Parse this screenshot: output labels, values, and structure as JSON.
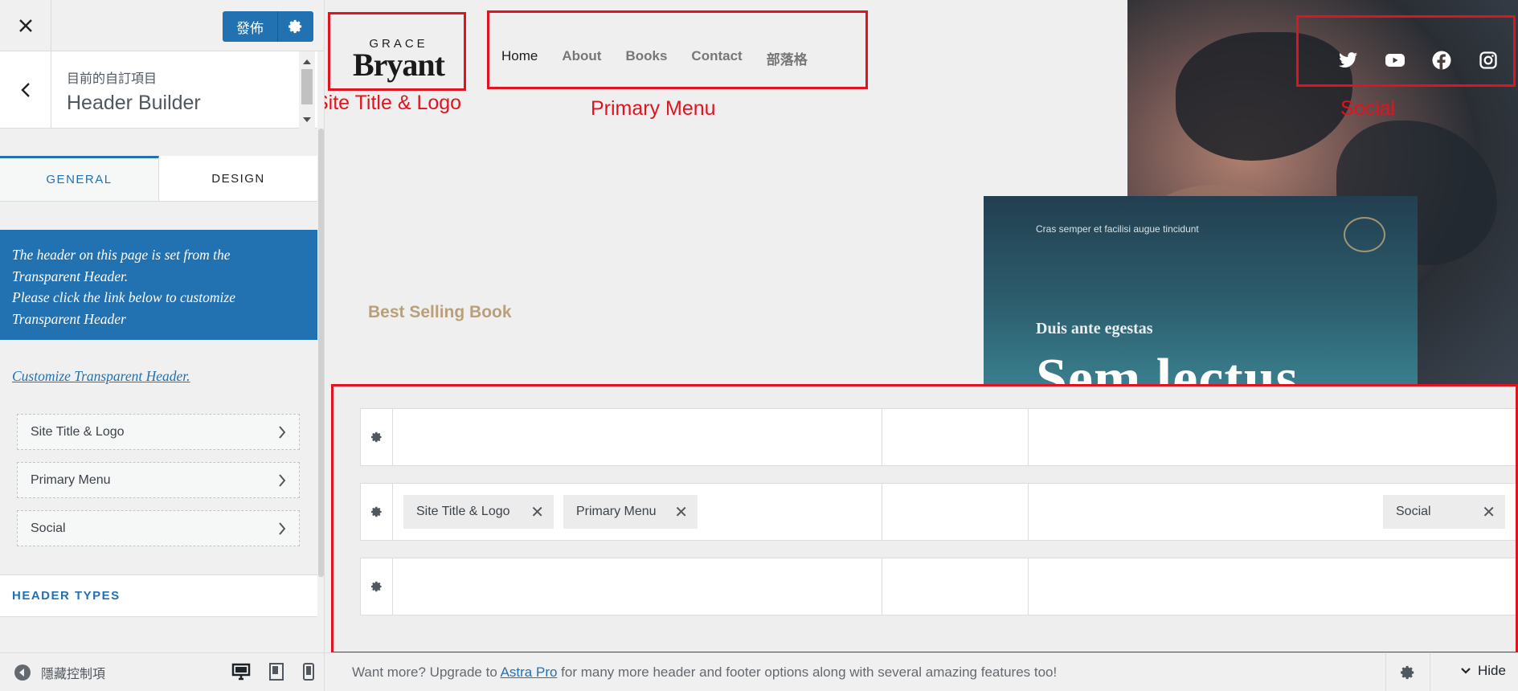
{
  "sidebar": {
    "publish_label": "發佈",
    "section_subtitle": "目前的自訂項目",
    "section_title": "Header Builder",
    "tabs": [
      {
        "label": "GENERAL",
        "active": true
      },
      {
        "label": "DESIGN",
        "active": false
      }
    ],
    "notice_lines": [
      "The header on this page is set from the",
      "Transparent Header.",
      "Please click the link below to customize",
      "Transparent Header"
    ],
    "customize_link": "Customize Transparent Header.",
    "components": [
      {
        "label": "Site Title & Logo"
      },
      {
        "label": "Primary Menu"
      },
      {
        "label": "Social"
      }
    ],
    "header_types_label": "HEADER TYPES",
    "hide_controls_label": "隱藏控制項"
  },
  "preview": {
    "logo": {
      "top": "GRACE",
      "main": "Bryant"
    },
    "nav": [
      "Home",
      "About",
      "Books",
      "Contact",
      "部落格"
    ],
    "social_icons": [
      "twitter-icon",
      "youtube-icon",
      "facebook-icon",
      "instagram-icon"
    ],
    "best_selling": "Best Selling Book",
    "book": {
      "top_text": "Cras semper et facilisi augue tincidunt",
      "subtitle": "Duis ante egestas",
      "title": "Sem lectus"
    },
    "annotations": {
      "logo": "Site Title & Logo",
      "menu": "Primary Menu",
      "social": "Social"
    },
    "builder_chips": {
      "logo": "Site Title & Logo",
      "menu": "Primary Menu",
      "social": "Social"
    }
  },
  "footer": {
    "msg_before": "Want more? Upgrade to ",
    "link": "Astra Pro",
    "msg_after": " for many more header and footer options along with several amazing features too!",
    "hide_label": "Hide"
  },
  "colors": {
    "accent": "#2271b1",
    "annotation": "#e0141e"
  }
}
